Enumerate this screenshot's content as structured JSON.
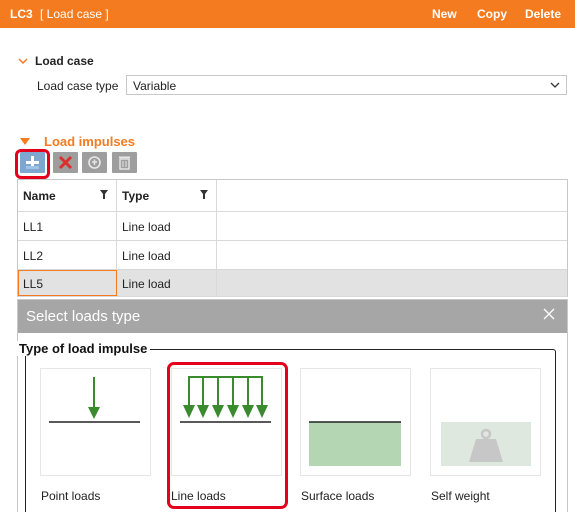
{
  "header": {
    "id": "LC3",
    "name": "[ Load case ]",
    "actions": {
      "new": "New",
      "copy": "Copy",
      "delete": "Delete"
    }
  },
  "load_case": {
    "section_title": "Load case",
    "type_label": "Load case type",
    "type_value": "Variable"
  },
  "load_impulses": {
    "section_title": "Load impulses",
    "toolbar": [
      "add-icon",
      "remove-icon",
      "copy-icon",
      "trash-icon"
    ],
    "columns": [
      "Name",
      "Type"
    ],
    "rows": [
      {
        "name": "LL1",
        "type": "Line load"
      },
      {
        "name": "LL2",
        "type": "Line load"
      },
      {
        "name": "LL5",
        "type": "Line load"
      }
    ],
    "selected_index": 2
  },
  "dialog": {
    "title": "Select loads type",
    "group_title": "Type of load impulse",
    "options": [
      {
        "label": "Point loads"
      },
      {
        "label": "Line loads"
      },
      {
        "label": "Surface loads"
      },
      {
        "label": "Self weight"
      }
    ],
    "highlighted_index": 1
  },
  "colors": {
    "accent": "#f47b20",
    "highlight": "#e4001b",
    "arrow_green": "#3a8a2e",
    "surface_green": "#b5d6b2"
  }
}
